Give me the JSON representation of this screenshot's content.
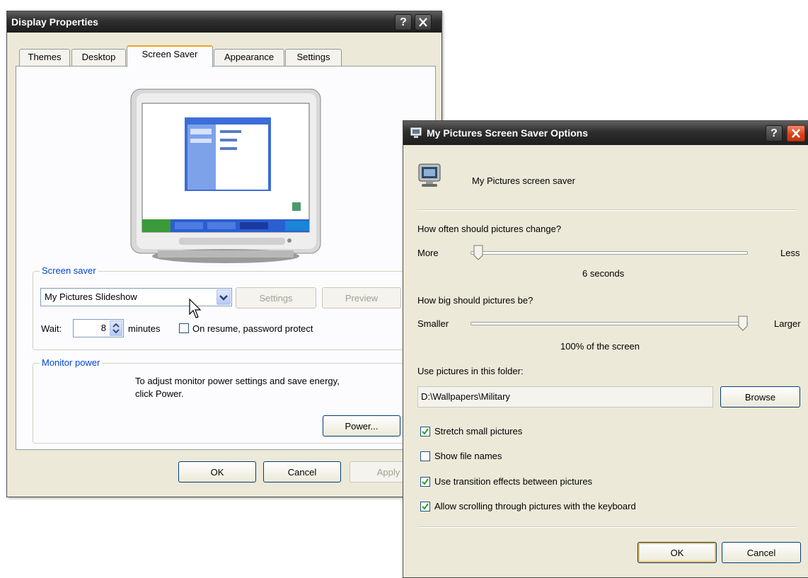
{
  "display_properties": {
    "title": "Display Properties",
    "help_btn": "?",
    "tabs": [
      {
        "label": "Themes"
      },
      {
        "label": "Desktop"
      },
      {
        "label": "Screen Saver"
      },
      {
        "label": "Appearance"
      },
      {
        "label": "Settings"
      }
    ],
    "screen_saver": {
      "group_label": "Screen saver",
      "selected": "My Pictures Slideshow",
      "settings_btn": "Settings",
      "preview_btn": "Preview",
      "wait_label": "Wait:",
      "wait_value": "8",
      "minutes_label": "minutes",
      "password_label": "On resume, password protect",
      "password_checked": false
    },
    "monitor_power": {
      "group_label": "Monitor power",
      "text_line1": "To adjust monitor power settings and save energy,",
      "text_line2": "click Power.",
      "power_btn": "Power..."
    },
    "footer": {
      "ok": "OK",
      "cancel": "Cancel",
      "apply": "Apply"
    }
  },
  "options_dialog": {
    "title": "My Pictures Screen Saver Options",
    "help_btn": "?",
    "header_text": "My Pictures screen saver",
    "change_question": "How often should pictures change?",
    "change_min_label": "More",
    "change_max_label": "Less",
    "change_value": "6 seconds",
    "change_slider_level": 0.0,
    "size_question": "How big should pictures be?",
    "size_min_label": "Smaller",
    "size_max_label": "Larger",
    "size_value": "100% of the screen",
    "size_slider_level": 1.0,
    "folder_label": "Use pictures in this folder:",
    "folder_path": "D:\\Wallpapers\\Military",
    "browse_btn": "Browse",
    "options": [
      {
        "label": "Stretch small pictures",
        "checked": true
      },
      {
        "label": "Show file names",
        "checked": false
      },
      {
        "label": "Use transition effects between pictures",
        "checked": true
      },
      {
        "label": "Allow scrolling through pictures with the keyboard",
        "checked": true
      }
    ],
    "ok_btn": "OK",
    "cancel_btn": "Cancel"
  }
}
